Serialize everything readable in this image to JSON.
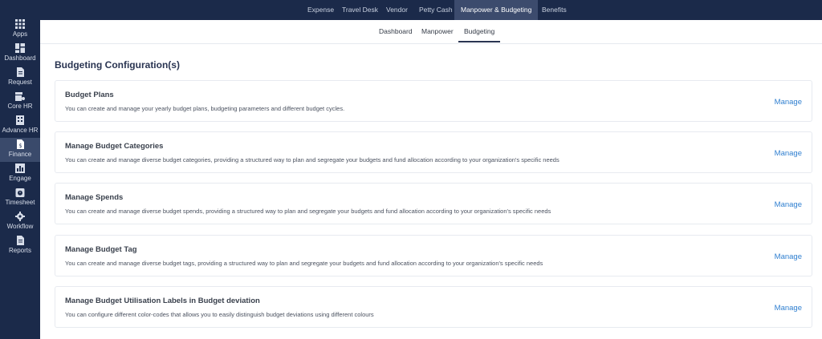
{
  "sidebar": {
    "items": [
      {
        "label": "Apps",
        "icon": "apps-grid-icon"
      },
      {
        "label": "Dashboard",
        "icon": "dashboard-icon"
      },
      {
        "label": "Request",
        "icon": "request-document-icon"
      },
      {
        "label": "Core HR",
        "icon": "core-hr-icon"
      },
      {
        "label": "Advance HR",
        "icon": "advance-hr-building-icon"
      },
      {
        "label": "Finance",
        "icon": "finance-dollar-icon",
        "active": true
      },
      {
        "label": "Engage",
        "icon": "engage-chart-icon"
      },
      {
        "label": "Timesheet",
        "icon": "timesheet-icon"
      },
      {
        "label": "Workflow",
        "icon": "workflow-gear-icon"
      },
      {
        "label": "Reports",
        "icon": "reports-icon"
      }
    ]
  },
  "topnav": {
    "items": [
      {
        "label": "Expense"
      },
      {
        "label": "Travel Desk"
      },
      {
        "label": "Vendor"
      },
      {
        "label": "Petty Cash"
      },
      {
        "label": "Manpower & Budgeting",
        "active": true
      },
      {
        "label": "Benefits"
      }
    ]
  },
  "subtabs": {
    "items": [
      {
        "label": "Dashboard"
      },
      {
        "label": "Manpower"
      },
      {
        "label": "Budgeting",
        "active": true
      }
    ]
  },
  "main": {
    "title": "Budgeting Configuration(s)",
    "cards": [
      {
        "title": "Budget Plans",
        "description": "You can create and manage your yearly budget plans, budgeting parameters and different budget cycles.",
        "action": "Manage"
      },
      {
        "title": "Manage Budget Categories",
        "description": "You can create and manage diverse budget categories, providing a structured way to plan and segregate your budgets and fund allocation according to your organization's specific needs",
        "action": "Manage"
      },
      {
        "title": "Manage Spends",
        "description": "You can create and manage diverse budget spends, providing a structured way to plan and segregate your budgets and fund allocation according to your organization's specific needs",
        "action": "Manage"
      },
      {
        "title": "Manage Budget Tag",
        "description": "You can create and manage diverse budget tags, providing a structured way to plan and segregate your budgets and fund allocation according to your organization's specific needs",
        "action": "Manage"
      },
      {
        "title": "Manage Budget Utilisation Labels in Budget deviation",
        "description": "You can configure different color-codes that allows you to easily distinguish budget deviations using different colours",
        "action": "Manage"
      }
    ]
  },
  "colors": {
    "sidebar_bg": "#1b2a4a",
    "active_bg": "#3a4a6b",
    "link": "#2f7fd0",
    "title": "#2a3552"
  }
}
